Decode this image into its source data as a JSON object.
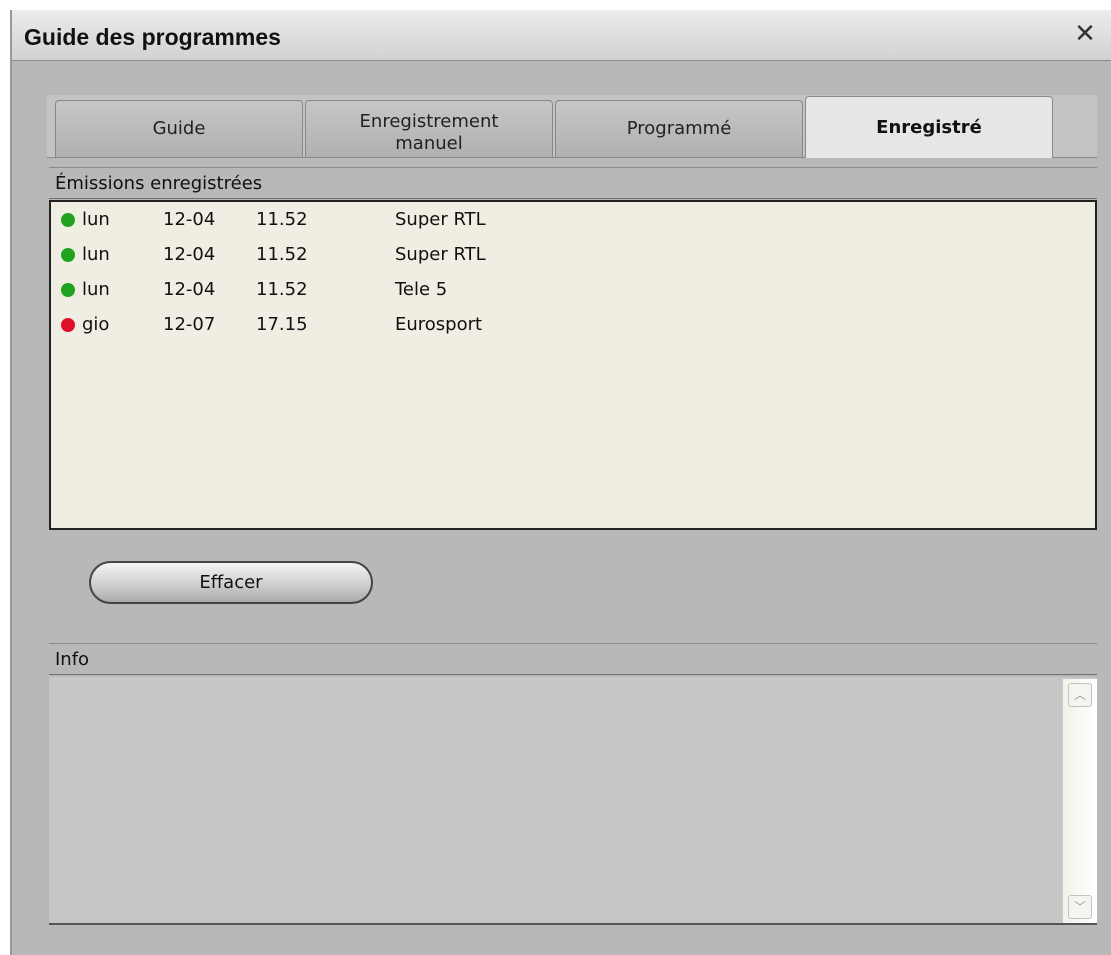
{
  "window": {
    "title": "Guide des programmes",
    "close_glyph": "✕"
  },
  "tabs": [
    {
      "label": "Guide",
      "active": false
    },
    {
      "label": "Enregistrement manuel",
      "active": false
    },
    {
      "label": "Programmé",
      "active": false
    },
    {
      "label": "Enregistré",
      "active": true
    }
  ],
  "recordings": {
    "header": "Émissions enregistrées",
    "rows": [
      {
        "status_color": "#1fa31f",
        "day": "lun",
        "date": "12-04",
        "time": "11.52",
        "channel": "Super RTL"
      },
      {
        "status_color": "#1fa31f",
        "day": "lun",
        "date": "12-04",
        "time": "11.52",
        "channel": "Super RTL"
      },
      {
        "status_color": "#1fa31f",
        "day": "lun",
        "date": "12-04",
        "time": "11.52",
        "channel": "Tele 5"
      },
      {
        "status_color": "#e0102a",
        "day": "gio",
        "date": "12-07",
        "time": "17.15",
        "channel": "Eurosport"
      }
    ]
  },
  "actions": {
    "delete_label": "Effacer"
  },
  "info": {
    "header": "Info",
    "scroll_up_glyph": "︿",
    "scroll_down_glyph": "﹀"
  }
}
